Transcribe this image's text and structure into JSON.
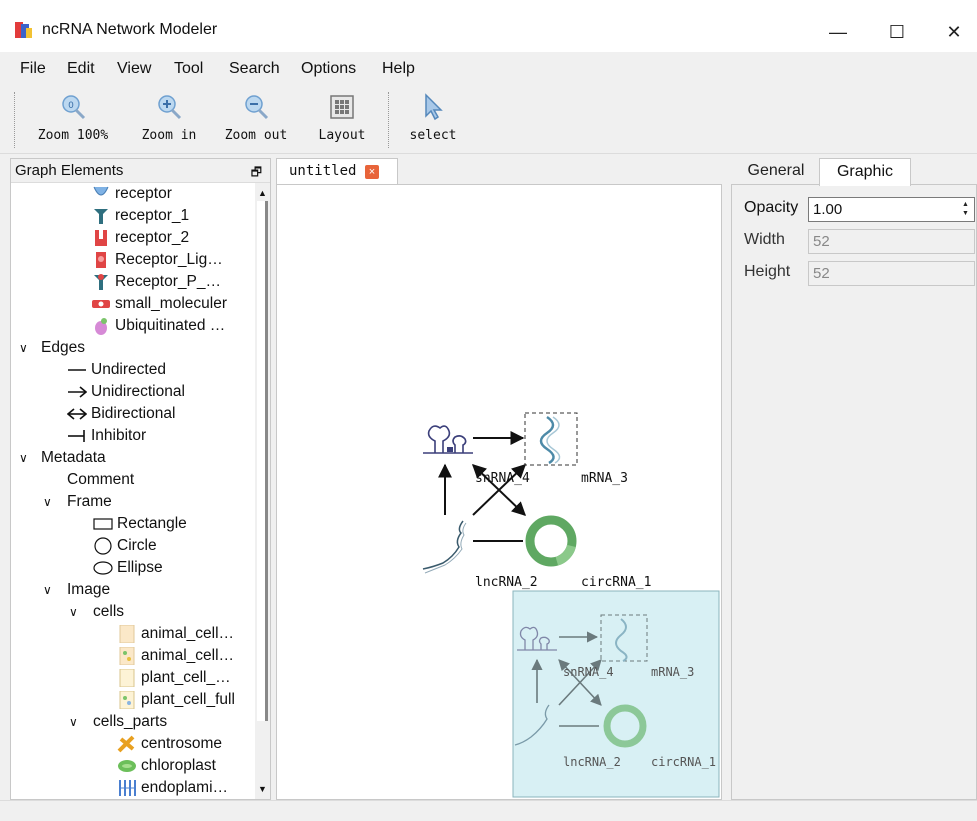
{
  "window": {
    "title": "ncRNA Network Modeler"
  },
  "menu": [
    "File",
    "Edit",
    "View",
    "Tool",
    "Search",
    "Options",
    "Help"
  ],
  "toolbar": {
    "zoom100": "Zoom 100%",
    "zoom_in": "Zoom in",
    "zoom_out": "Zoom out",
    "layout": "Layout",
    "select": "select"
  },
  "left_panel": {
    "title": "Graph Elements",
    "items": [
      "receptor",
      "receptor_1",
      "receptor_2",
      "Receptor_Lig…",
      "Receptor_P_…",
      "small_moleculer",
      "Ubiquitinated …",
      "Edges",
      "Undirected",
      "Unidirectional",
      "Bidirectional",
      "Inhibitor",
      "Metadata",
      "Comment",
      "Frame",
      "Rectangle",
      "Circle",
      "Ellipse",
      "Image",
      "cells",
      "animal_cell…",
      "animal_cell…",
      "plant_cell_…",
      "plant_cell_full",
      "cells_parts",
      "centrosome",
      "chloroplast",
      "endoplami…"
    ]
  },
  "document": {
    "tab": "untitled",
    "nodes": {
      "snrna": "snRNA_4",
      "mrna": "mRNA_3",
      "lncrna": "lncRNA_2",
      "circrna": "circRNA_1"
    }
  },
  "properties": {
    "tabs": {
      "general": "General",
      "graphic": "Graphic"
    },
    "opacity_label": "Opacity",
    "opacity_value": "1.00",
    "width_label": "Width",
    "width_value": "52",
    "height_label": "Height",
    "height_value": "52"
  },
  "colors": {
    "accent_blue": "#4a90d9",
    "minimap_bg": "#d8f0f4",
    "circ_green": "#5fa862",
    "tab_close": "#e8643a"
  }
}
